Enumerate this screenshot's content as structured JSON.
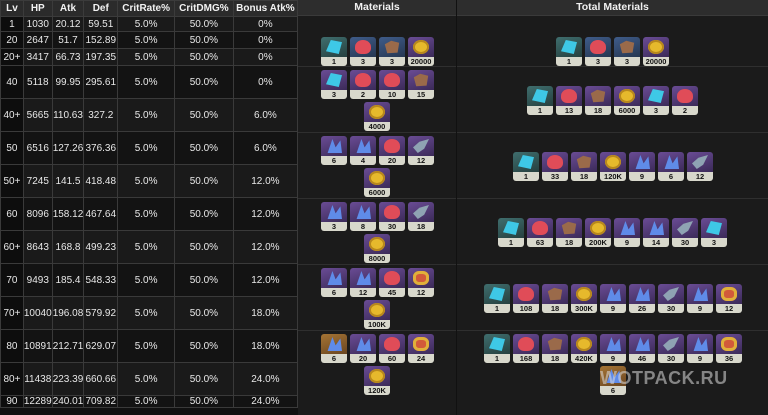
{
  "stats": {
    "headers": [
      "Lv",
      "HP",
      "Atk",
      "Def",
      "CritRate%",
      "CritDMG%",
      "Bonus Atk%"
    ],
    "rows": [
      [
        "1",
        "1030",
        "20.12",
        "59.51",
        "5.0%",
        "50.0%",
        "0%"
      ],
      [
        "20",
        "2647",
        "51.7",
        "152.89",
        "5.0%",
        "50.0%",
        "0%"
      ],
      [
        "20+",
        "3417",
        "66.73",
        "197.35",
        "5.0%",
        "50.0%",
        "0%"
      ],
      [
        "40",
        "5118",
        "99.95",
        "295.61",
        "5.0%",
        "50.0%",
        "0%"
      ],
      [
        "40+",
        "5665",
        "110.63",
        "327.2",
        "5.0%",
        "50.0%",
        "6.0%"
      ],
      [
        "50",
        "6516",
        "127.26",
        "376.36",
        "5.0%",
        "50.0%",
        "6.0%"
      ],
      [
        "50+",
        "7245",
        "141.5",
        "418.48",
        "5.0%",
        "50.0%",
        "12.0%"
      ],
      [
        "60",
        "8096",
        "158.12",
        "467.64",
        "5.0%",
        "50.0%",
        "12.0%"
      ],
      [
        "60+",
        "8643",
        "168.8",
        "499.23",
        "5.0%",
        "50.0%",
        "12.0%"
      ],
      [
        "70",
        "9493",
        "185.4",
        "548.33",
        "5.0%",
        "50.0%",
        "12.0%"
      ],
      [
        "70+",
        "10040",
        "196.08",
        "579.92",
        "5.0%",
        "50.0%",
        "18.0%"
      ],
      [
        "80",
        "10891",
        "212.71",
        "629.07",
        "5.0%",
        "50.0%",
        "18.0%"
      ],
      [
        "80+",
        "11438",
        "223.39",
        "660.66",
        "5.0%",
        "50.0%",
        "24.0%"
      ],
      [
        "90",
        "12289",
        "240.01",
        "709.82",
        "5.0%",
        "50.0%",
        "24.0%"
      ]
    ]
  },
  "materials": {
    "title": "Materials",
    "groups": [
      [
        {
          "icon": "crystal-icon",
          "rarity": "teal",
          "qty": "1"
        },
        {
          "icon": "ore-icon",
          "rarity": "blue",
          "qty": "3"
        },
        {
          "icon": "leather-icon",
          "rarity": "blue",
          "qty": "3"
        },
        {
          "icon": "coin-icon",
          "rarity": "purple",
          "qty": "20000"
        }
      ],
      [
        {
          "icon": "crystal-icon",
          "rarity": "purple",
          "qty": "3"
        },
        {
          "icon": "ore-icon",
          "rarity": "purple",
          "qty": "2"
        },
        {
          "icon": "ore-icon",
          "rarity": "purple",
          "qty": "10"
        },
        {
          "icon": "leather-icon",
          "rarity": "purple",
          "qty": "15"
        },
        {
          "icon": "coin-icon",
          "rarity": "purple",
          "qty": "4000"
        }
      ],
      [
        {
          "icon": "shard-icon",
          "rarity": "purple",
          "qty": "6"
        },
        {
          "icon": "shard-icon",
          "rarity": "purple",
          "qty": "4"
        },
        {
          "icon": "ore-icon",
          "rarity": "purple",
          "qty": "20"
        },
        {
          "icon": "fin-icon",
          "rarity": "purple",
          "qty": "12"
        },
        {
          "icon": "coin-icon",
          "rarity": "purple",
          "qty": "6000"
        }
      ],
      [
        {
          "icon": "shard-icon",
          "rarity": "purple",
          "qty": "3"
        },
        {
          "icon": "shard-icon",
          "rarity": "purple",
          "qty": "8"
        },
        {
          "icon": "ore-icon",
          "rarity": "purple",
          "qty": "30"
        },
        {
          "icon": "fin-icon",
          "rarity": "purple",
          "qty": "18"
        },
        {
          "icon": "coin-icon",
          "rarity": "purple",
          "qty": "8000"
        }
      ],
      [
        {
          "icon": "shard-icon",
          "rarity": "purple",
          "qty": "6"
        },
        {
          "icon": "shard-icon",
          "rarity": "purple",
          "qty": "12"
        },
        {
          "icon": "ore-icon",
          "rarity": "purple",
          "qty": "45"
        },
        {
          "icon": "gem-icon",
          "rarity": "purple",
          "qty": "12"
        },
        {
          "icon": "coin-icon",
          "rarity": "purple",
          "qty": "100K"
        }
      ],
      [
        {
          "icon": "shard-icon",
          "rarity": "gold",
          "qty": "6"
        },
        {
          "icon": "shard-icon",
          "rarity": "purple",
          "qty": "20"
        },
        {
          "icon": "ore-icon",
          "rarity": "purple",
          "qty": "60"
        },
        {
          "icon": "gem-icon",
          "rarity": "purple",
          "qty": "24"
        },
        {
          "icon": "coin-icon",
          "rarity": "purple",
          "qty": "120K"
        }
      ]
    ]
  },
  "total_materials": {
    "title": "Total Materials",
    "groups": [
      [
        {
          "icon": "crystal-icon",
          "rarity": "teal",
          "qty": "1"
        },
        {
          "icon": "ore-icon",
          "rarity": "blue",
          "qty": "3"
        },
        {
          "icon": "leather-icon",
          "rarity": "blue",
          "qty": "3"
        },
        {
          "icon": "coin-icon",
          "rarity": "purple",
          "qty": "20000"
        }
      ],
      [
        {
          "icon": "crystal-icon",
          "rarity": "teal",
          "qty": "1"
        },
        {
          "icon": "ore-icon",
          "rarity": "purple",
          "qty": "13"
        },
        {
          "icon": "leather-icon",
          "rarity": "purple",
          "qty": "18"
        },
        {
          "icon": "coin-icon",
          "rarity": "purple",
          "qty": "6000"
        },
        {
          "icon": "crystal-icon",
          "rarity": "purple",
          "qty": "3"
        },
        {
          "icon": "ore-icon",
          "rarity": "purple",
          "qty": "2"
        }
      ],
      [
        {
          "icon": "crystal-icon",
          "rarity": "teal",
          "qty": "1"
        },
        {
          "icon": "ore-icon",
          "rarity": "purple",
          "qty": "33"
        },
        {
          "icon": "leather-icon",
          "rarity": "purple",
          "qty": "18"
        },
        {
          "icon": "coin-icon",
          "rarity": "purple",
          "qty": "120K"
        },
        {
          "icon": "shard-icon",
          "rarity": "purple",
          "qty": "9"
        },
        {
          "icon": "shard-icon",
          "rarity": "purple",
          "qty": "6"
        },
        {
          "icon": "fin-icon",
          "rarity": "purple",
          "qty": "12"
        }
      ],
      [
        {
          "icon": "crystal-icon",
          "rarity": "teal",
          "qty": "1"
        },
        {
          "icon": "ore-icon",
          "rarity": "purple",
          "qty": "63"
        },
        {
          "icon": "leather-icon",
          "rarity": "purple",
          "qty": "18"
        },
        {
          "icon": "coin-icon",
          "rarity": "purple",
          "qty": "200K"
        },
        {
          "icon": "shard-icon",
          "rarity": "purple",
          "qty": "9"
        },
        {
          "icon": "shard-icon",
          "rarity": "purple",
          "qty": "14"
        },
        {
          "icon": "fin-icon",
          "rarity": "purple",
          "qty": "30"
        },
        {
          "icon": "crystal-icon",
          "rarity": "purple",
          "qty": "3"
        }
      ],
      [
        {
          "icon": "crystal-icon",
          "rarity": "teal",
          "qty": "1"
        },
        {
          "icon": "ore-icon",
          "rarity": "purple",
          "qty": "108"
        },
        {
          "icon": "leather-icon",
          "rarity": "purple",
          "qty": "18"
        },
        {
          "icon": "coin-icon",
          "rarity": "purple",
          "qty": "300K"
        },
        {
          "icon": "shard-icon",
          "rarity": "purple",
          "qty": "9"
        },
        {
          "icon": "shard-icon",
          "rarity": "purple",
          "qty": "26"
        },
        {
          "icon": "fin-icon",
          "rarity": "purple",
          "qty": "30"
        },
        {
          "icon": "shard-icon",
          "rarity": "purple",
          "qty": "9"
        },
        {
          "icon": "gem-icon",
          "rarity": "purple",
          "qty": "12"
        }
      ],
      [
        {
          "icon": "crystal-icon",
          "rarity": "teal",
          "qty": "1"
        },
        {
          "icon": "ore-icon",
          "rarity": "purple",
          "qty": "168"
        },
        {
          "icon": "leather-icon",
          "rarity": "purple",
          "qty": "18"
        },
        {
          "icon": "coin-icon",
          "rarity": "purple",
          "qty": "420K"
        },
        {
          "icon": "shard-icon",
          "rarity": "purple",
          "qty": "9"
        },
        {
          "icon": "shard-icon",
          "rarity": "purple",
          "qty": "46"
        },
        {
          "icon": "fin-icon",
          "rarity": "purple",
          "qty": "30"
        },
        {
          "icon": "shard-icon",
          "rarity": "purple",
          "qty": "9"
        },
        {
          "icon": "gem-icon",
          "rarity": "purple",
          "qty": "36"
        },
        {
          "icon": "shard-icon",
          "rarity": "gold",
          "qty": "6"
        }
      ]
    ]
  },
  "watermark": "WOTPACK.RU"
}
